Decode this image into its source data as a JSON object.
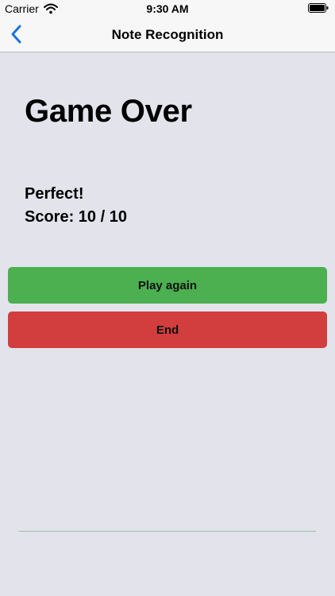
{
  "status_bar": {
    "carrier": "Carrier",
    "time": "9:30 AM",
    "icons": [
      "wifi-icon",
      "battery-icon"
    ]
  },
  "nav": {
    "title": "Note Recognition",
    "back_icon": "chevron-left-icon",
    "accent_color": "#1a73d9"
  },
  "main": {
    "heading": "Game Over",
    "result": "Perfect!",
    "score": "Score: 10 / 10"
  },
  "buttons": {
    "play_again": {
      "label": "Play again",
      "color": "#4caf50"
    },
    "end": {
      "label": "End",
      "color": "#d23e3e"
    }
  },
  "colors": {
    "background": "#e3e3ec",
    "bar_background": "#f7f7f7"
  }
}
